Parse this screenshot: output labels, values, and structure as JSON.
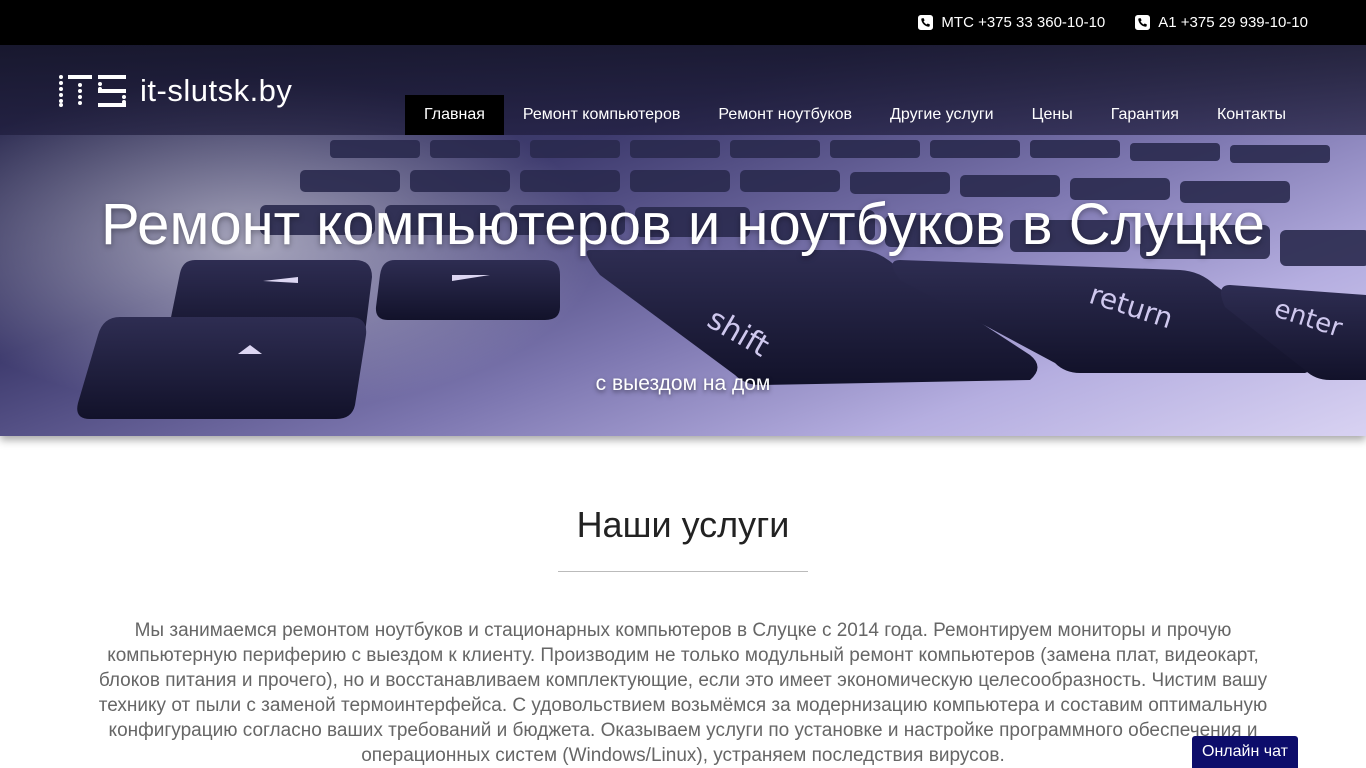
{
  "topbar": {
    "phones": [
      {
        "text": "МТС +375 33 360-10-10",
        "icon": "phone-icon"
      },
      {
        "text": "A1 +375 29 939-10-10",
        "icon": "phone-icon"
      }
    ]
  },
  "logo": {
    "mark": "ITS",
    "text": "it-slutsk.by"
  },
  "nav": [
    {
      "label": "Главная",
      "active": true
    },
    {
      "label": "Ремонт компьютеров"
    },
    {
      "label": "Ремонт ноутбуков"
    },
    {
      "label": "Другие услуги"
    },
    {
      "label": "Цены"
    },
    {
      "label": "Гарантия"
    },
    {
      "label": "Контакты"
    }
  ],
  "hero": {
    "title": "Ремонт компьютеров и ноутбуков в Слуцке",
    "subtitle": "с выездом на дом",
    "keys": [
      "shift",
      "return",
      "enter"
    ]
  },
  "services": {
    "title": "Наши услуги",
    "text": "Мы занимаемся ремонтом ноутбуков и стационарных компьютеров в Слуцке с 2014 года. Ремонтируем мониторы и прочую компьютерную периферию с выездом к клиенту. Производим не только модульный ремонт компьютеров (замена плат, видеокарт, блоков питания и прочего), но и восстанавливаем комплектующие, если это имеет экономическую целесообразность. Чистим вашу технику от пыли с заменой термоинтерфейса. С удовольствием возьмёмся за модернизацию компьютера и составим оптимальную конфигурацию согласно ваших требований и бюджета. Оказываем услуги по установке и настройке программного обеспечения и операционных систем (Windows/Linux), устраняем последствия вирусов."
  },
  "chat": {
    "label": "Онлайн чат"
  },
  "colors": {
    "topbar": "#000000",
    "nav_active": "#000000",
    "chat": "#0d0d6b",
    "text": "#666666"
  }
}
